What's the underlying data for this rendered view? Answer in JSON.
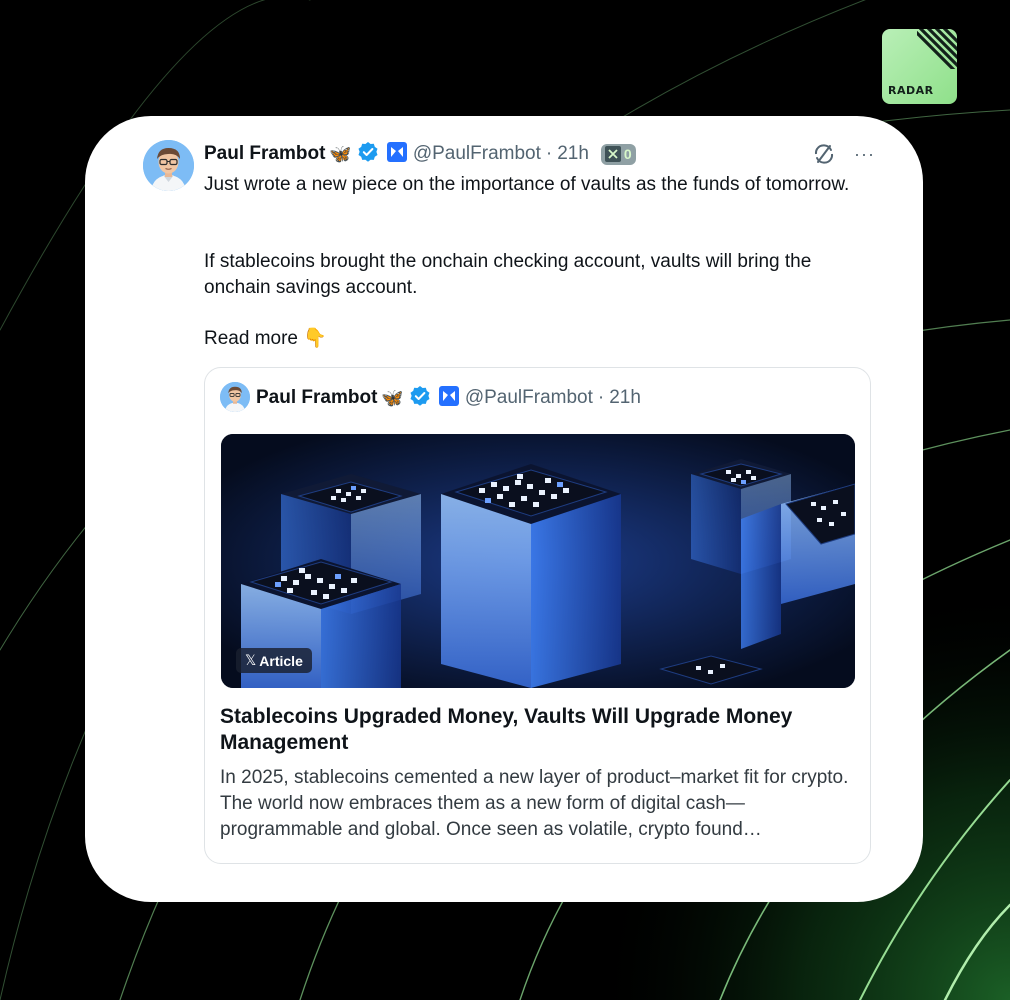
{
  "brand": {
    "logo_label": "RADAR",
    "accent": "#8fe08a"
  },
  "tweet": {
    "author_name": "Paul Frambot",
    "author_emoji": "🦋",
    "handle": "@PaulFrambot",
    "separator": "·",
    "time": "21h",
    "badge_count": "0",
    "paragraph_1": "Just wrote a new piece on the importance of vaults as the funds of tomorrow.",
    "paragraph_2": "If stablecoins brought the onchain checking account, vaults will bring the onchain savings account.",
    "read_more": "Read more",
    "read_more_emoji": "👇",
    "more_icon": "···"
  },
  "quote": {
    "author_name": "Paul Frambot",
    "author_emoji": "🦋",
    "handle": "@PaulFrambot",
    "separator": "·",
    "time": "21h",
    "article_badge": "Article",
    "article_badge_x": "𝕏",
    "article_title": "Stablecoins Upgraded Money, Vaults Will Upgrade Money Management",
    "article_desc": "In 2025, stablecoins cemented a new layer of product–market fit for crypto. The world now embraces them as a new form of digital cash—programmable and global. Once seen as volatile, crypto found…"
  },
  "icons": {
    "verified": "verified-badge-icon",
    "affiliate": "morpho-affiliate-icon",
    "grok": "grok-icon",
    "more": "more-icon"
  },
  "colors": {
    "verified": "#1d9bf0",
    "affiliate": "#2470ff",
    "handle": "#536471"
  }
}
